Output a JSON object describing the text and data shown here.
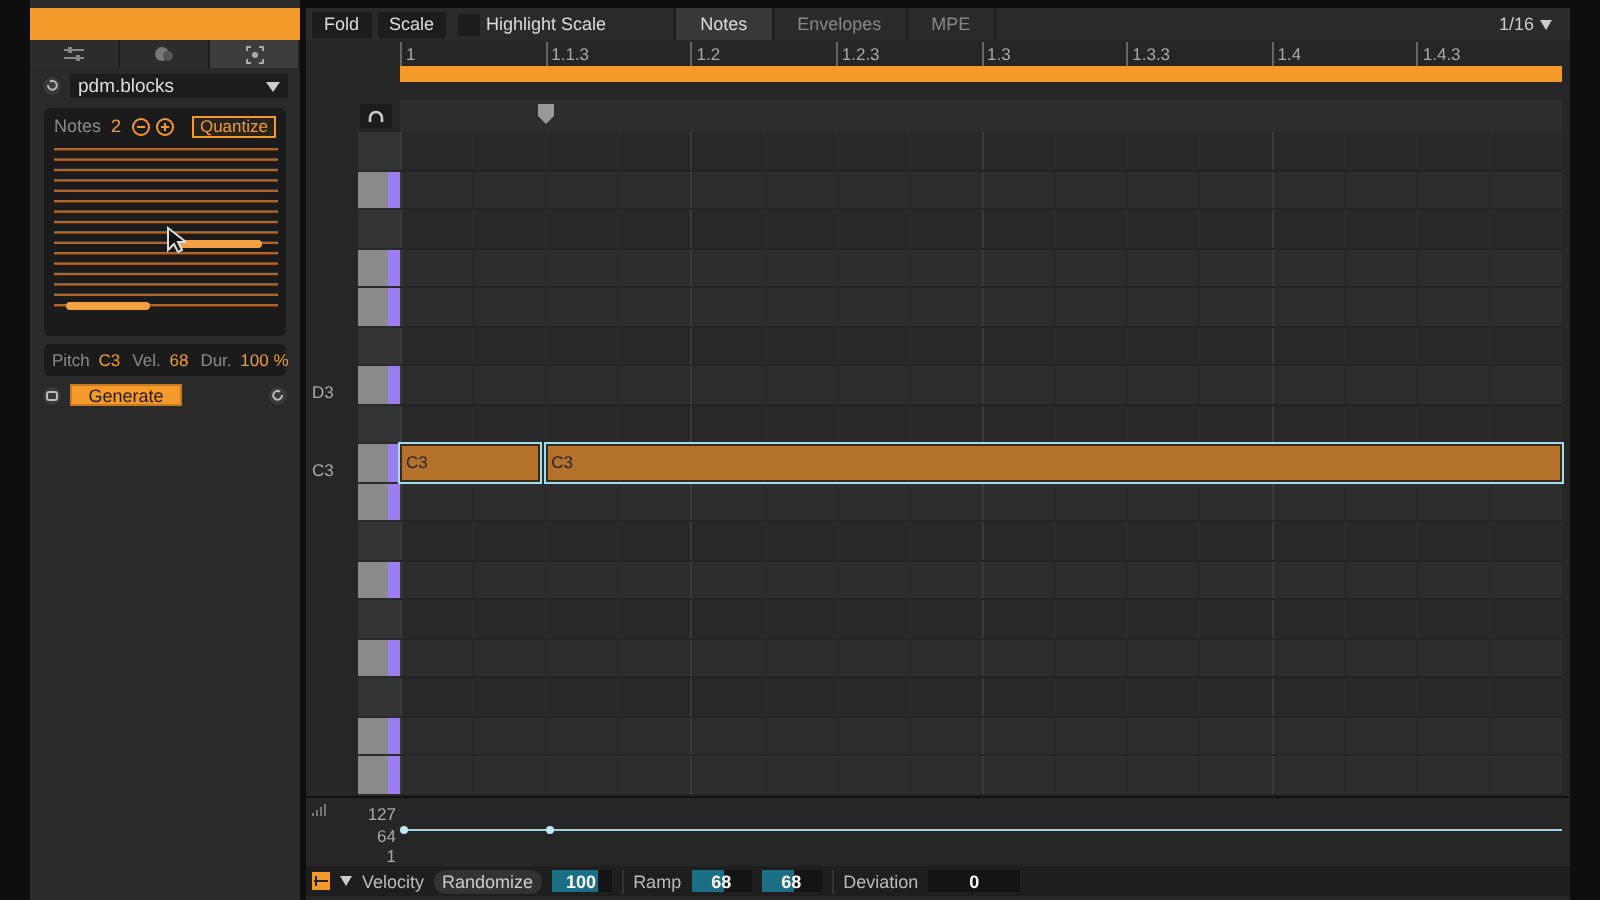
{
  "device_tabs": [
    {
      "kind": "sliders",
      "selected": false
    },
    {
      "kind": "dice",
      "selected": false
    },
    {
      "kind": "target",
      "selected": true
    }
  ],
  "device": {
    "name": "pdm.blocks"
  },
  "generator": {
    "notes_label": "Notes",
    "notes_count": "2",
    "quantize": "Quantize",
    "pitch_label": "Pitch",
    "pitch": "C3",
    "vel_label": "Vel.",
    "vel": "68",
    "dur_label": "Dur.",
    "dur": "100 %",
    "generate": "Generate"
  },
  "toolbar": {
    "fold": "Fold",
    "scale": "Scale",
    "highlight_scale": {
      "label": "Highlight Scale",
      "checked": false
    },
    "grid": "1/16"
  },
  "tabs": [
    {
      "label": "Notes",
      "selected": true
    },
    {
      "label": "Envelopes",
      "selected": false
    },
    {
      "label": "MPE",
      "selected": false
    }
  ],
  "ruler": [
    "1",
    "1.1.3",
    "1.2",
    "1.2.3",
    "1.3",
    "1.3.3",
    "1.4",
    "1.4.3"
  ],
  "keys": [
    {
      "kind": "black"
    },
    {
      "kind": "white"
    },
    {
      "kind": "black"
    },
    {
      "kind": "white"
    },
    {
      "kind": "white"
    },
    {
      "kind": "black"
    },
    {
      "kind": "white",
      "label": "D3"
    },
    {
      "kind": "black"
    },
    {
      "kind": "white",
      "label": "C3",
      "notes": [
        {
          "label": "C3",
          "selected": true
        },
        {
          "label": "C3",
          "selected": true
        }
      ]
    },
    {
      "kind": "white"
    },
    {
      "kind": "black"
    },
    {
      "kind": "white"
    },
    {
      "kind": "black"
    },
    {
      "kind": "white"
    },
    {
      "kind": "black"
    },
    {
      "kind": "white"
    },
    {
      "kind": "white"
    }
  ],
  "velocity_ticks": [
    "127",
    "64",
    "1"
  ],
  "bottom": {
    "velocity": "Velocity",
    "randomize": "Randomize",
    "velocity_value": {
      "value": "100",
      "level": 0.79
    },
    "ramp": "Ramp",
    "ramp_start": {
      "value": "68",
      "level": 0.54
    },
    "ramp_end": {
      "value": "68",
      "level": 0.54
    },
    "deviation": "Deviation",
    "deviation_value": {
      "value": "0"
    }
  }
}
